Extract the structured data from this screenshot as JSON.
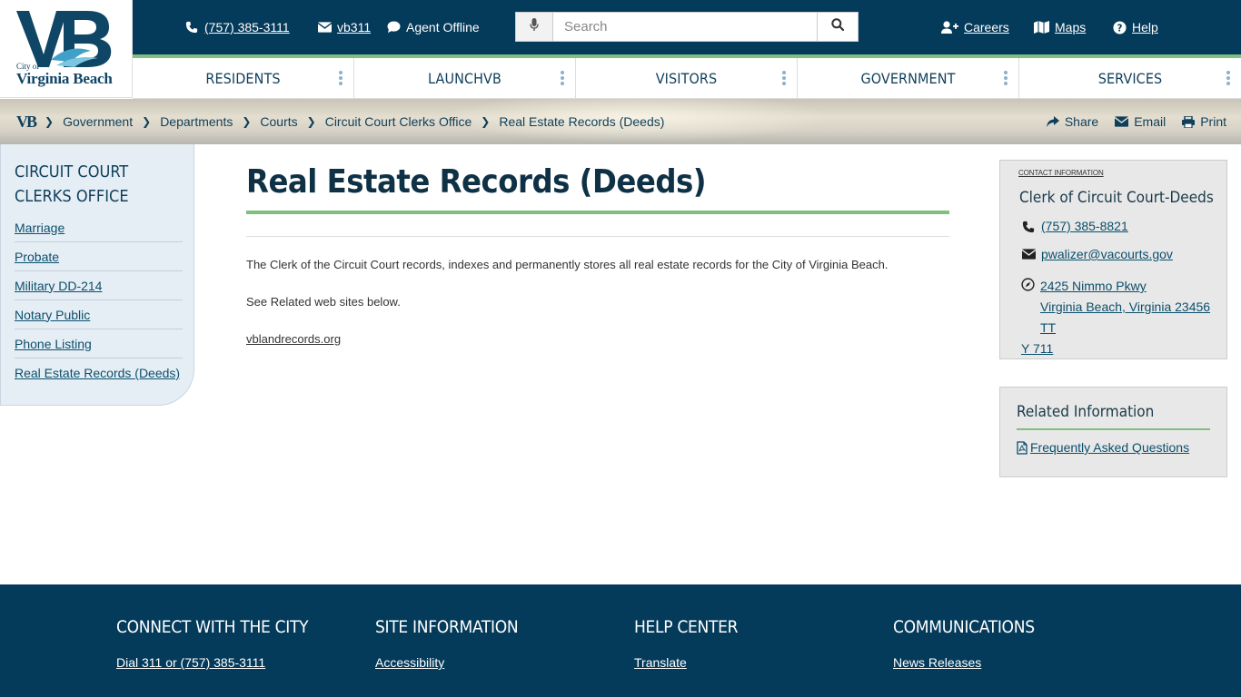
{
  "logo": {
    "city_of": "City of",
    "name": "Virginia Beach"
  },
  "topbar": {
    "phone": "(757) 385-3111",
    "vb311": "vb311",
    "agent_status": "Agent Offline",
    "search_placeholder": "Search",
    "careers": "Careers",
    "maps": "Maps",
    "help": "Help"
  },
  "nav": {
    "items": [
      "RESIDENTS",
      "LAUNCHVB",
      "VISITORS",
      "GOVERNMENT",
      "SERVICES"
    ]
  },
  "breadcrumb": {
    "home": "VB",
    "items": [
      "Government",
      "Departments",
      "Courts",
      "Circuit Court Clerks Office",
      "Real Estate Records (Deeds)"
    ]
  },
  "share_tools": {
    "share": "Share",
    "email": "Email",
    "print": "Print"
  },
  "sidebar": {
    "title": "CIRCUIT COURT CLERKS OFFICE",
    "items": [
      "Marriage",
      "Probate",
      "Military DD-214",
      "Notary Public",
      "Phone Listing",
      "Real Estate Records (Deeds)"
    ]
  },
  "main": {
    "title": "Real Estate Records (Deeds)",
    "paragraph1": "The Clerk of the Circuit Court records, indexes and permanently stores all real estate records for the City of Virginia Beach.",
    "paragraph2": "See Related web sites below.",
    "link": "vblandrecords.org"
  },
  "contact": {
    "label": "CONTACT INFORMATION",
    "name": "Clerk of Circuit Court-Deeds",
    "phone": "(757) 385-8821",
    "email": "pwalizer@vacourts.gov",
    "address_line1": "2425 Nimmo Pkwy",
    "address_line2": "Virginia Beach, Virginia  23456 TT",
    "address_line3": "Y 711"
  },
  "related": {
    "title": "Related Information",
    "link": "Frequently Asked Questions"
  },
  "footer": {
    "col1_heading": "CONNECT WITH THE CITY",
    "col1_link": "Dial 311 or (757) 385-3111",
    "col2_heading": "SITE INFORMATION",
    "col2_link": "Accessibility",
    "col3_heading": "HELP CENTER",
    "col3_link": "Translate",
    "col4_heading": "COMMUNICATIONS",
    "col4_link": "News Releases"
  },
  "colors": {
    "navy": "#043a5a",
    "green_accent": "#7fbf7f",
    "link_blue": "#0b4f6c",
    "sidebar_bg": "#e6eef5"
  },
  "icons": [
    "phone-icon",
    "envelope-icon",
    "chat-bubble-icon",
    "microphone-icon",
    "search-icon",
    "user-plus-icon",
    "map-icon",
    "question-circle-icon",
    "chevron-right-icon",
    "share-icon",
    "print-icon",
    "compass-icon",
    "pdf-file-icon",
    "more-vertical-icon"
  ]
}
